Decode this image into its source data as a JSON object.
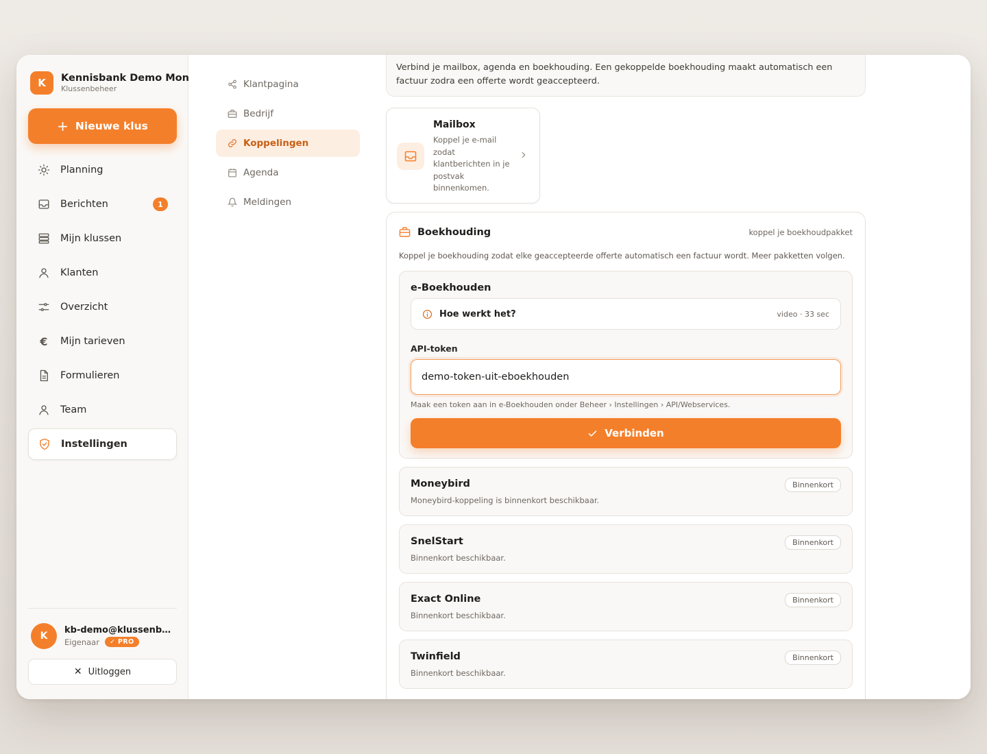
{
  "brand": {
    "logo_letter": "K",
    "name": "Kennisbank Demo Montage",
    "subtitle": "Klussenbeheer"
  },
  "new_button": {
    "label": "Nieuwe klus"
  },
  "nav": {
    "items": [
      {
        "label": "Planning",
        "icon": "sun-icon"
      },
      {
        "label": "Berichten",
        "icon": "inbox-icon",
        "badge": "1"
      },
      {
        "label": "Mijn klussen",
        "icon": "stack-icon"
      },
      {
        "label": "Klanten",
        "icon": "user-icon"
      },
      {
        "label": "Overzicht",
        "icon": "sliders-icon"
      },
      {
        "label": "Mijn tarieven",
        "icon": "euro-icon"
      },
      {
        "label": "Formulieren",
        "icon": "document-icon"
      },
      {
        "label": "Team",
        "icon": "user-icon"
      },
      {
        "label": "Instellingen",
        "icon": "shield-icon",
        "active": true
      }
    ]
  },
  "user": {
    "avatar_letter": "K",
    "email": "kb-demo@klussenbeheer.nl",
    "role": "Eigenaar",
    "plan_badge": "✓ PRO"
  },
  "logout": {
    "label": "Uitloggen"
  },
  "subnav": {
    "items": [
      {
        "label": "Klantpagina",
        "icon": "share-icon"
      },
      {
        "label": "Bedrijf",
        "icon": "briefcase-icon"
      },
      {
        "label": "Koppelingen",
        "icon": "link-icon",
        "active": true
      },
      {
        "label": "Agenda",
        "icon": "calendar-icon"
      },
      {
        "label": "Meldingen",
        "icon": "bell-icon"
      }
    ]
  },
  "intro": {
    "text": "Verbind je mailbox, agenda en boekhouding. Een gekoppelde boekhouding maakt automatisch een factuur zodra een offerte wordt geaccepteerd."
  },
  "mailbox": {
    "title": "Mailbox",
    "description": "Koppel je e-mail zodat klantberichten in je postvak binnenkomen."
  },
  "accounting": {
    "title": "Boekhouding",
    "hint": "koppel je boekhoudpakket",
    "description": "Koppel je boekhouding zodat elke geaccepteerde offerte automatisch een factuur wordt. Meer pakketten volgen.",
    "active_provider": {
      "name": "e-Boekhouden",
      "how_label": "Hoe werkt het?",
      "how_meta": "video · 33 sec",
      "api_label": "API-token",
      "api_value": "demo-token-uit-eboekhouden",
      "api_help": "Maak een token aan in e-Boekhouden onder Beheer › Instellingen › API/Webservices.",
      "connect_label": "Verbinden"
    },
    "providers": [
      {
        "name": "Moneybird",
        "description": "Moneybird-koppeling is binnenkort beschikbaar.",
        "status": "Binnenkort"
      },
      {
        "name": "SnelStart",
        "description": "Binnenkort beschikbaar.",
        "status": "Binnenkort"
      },
      {
        "name": "Exact Online",
        "description": "Binnenkort beschikbaar.",
        "status": "Binnenkort"
      },
      {
        "name": "Twinfield",
        "description": "Binnenkort beschikbaar.",
        "status": "Binnenkort"
      }
    ]
  },
  "colors": {
    "accent": "#f47f2a",
    "accent_soft": "#fdeee2",
    "background": "#ece8e3"
  }
}
